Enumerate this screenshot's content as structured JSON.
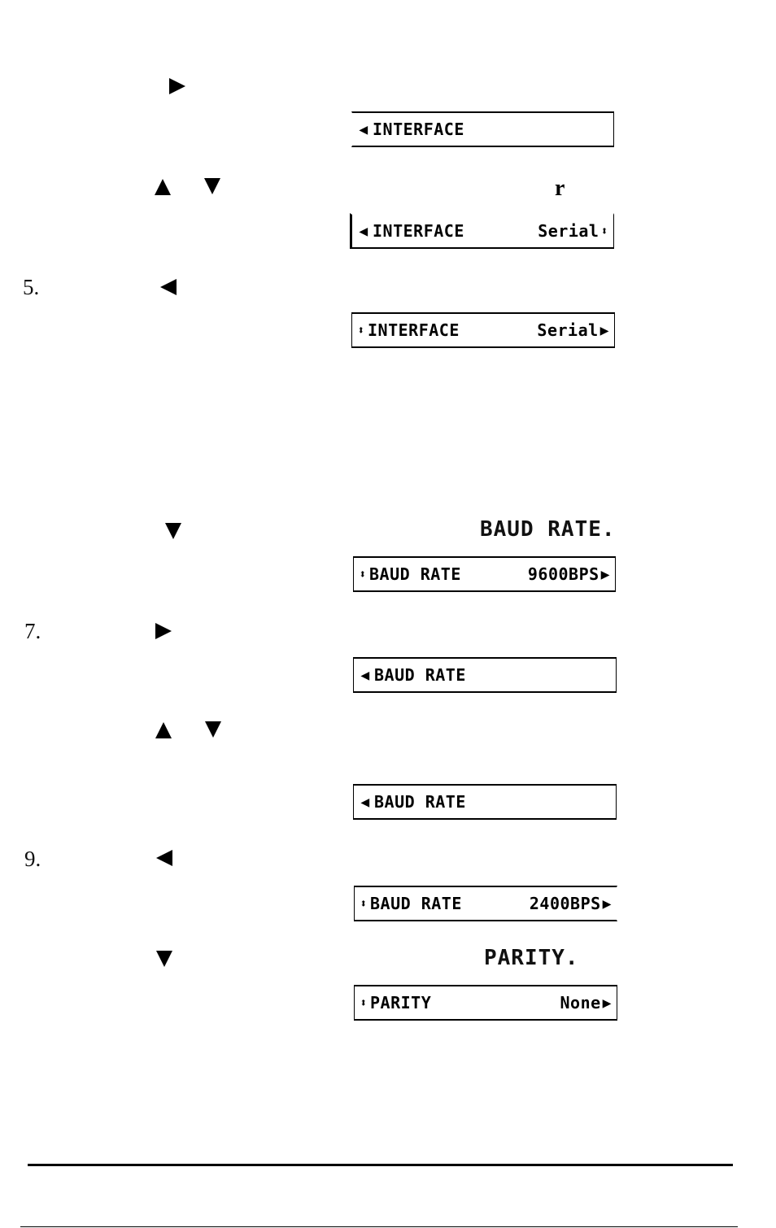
{
  "page": {
    "steps": [
      {
        "number": "",
        "button": "right-arrow"
      },
      {
        "number": "",
        "buttons": [
          "up-arrow",
          "down-arrow"
        ]
      },
      {
        "number": "5.",
        "button": "left-arrow"
      },
      {
        "number": "",
        "button": "down-arrow",
        "inline_setting": "BAUD RATE."
      },
      {
        "number": "7.",
        "button": "right-arrow"
      },
      {
        "number": "",
        "buttons": [
          "up-arrow",
          "down-arrow"
        ]
      },
      {
        "number": "9.",
        "button": "left-arrow"
      },
      {
        "number": "",
        "button": "down-arrow",
        "inline_setting": "PARITY."
      }
    ],
    "stray_char": "r",
    "displays": [
      {
        "lead": "◀",
        "label": "INTERFACE",
        "value": "",
        "trail": ""
      },
      {
        "lead": "◀",
        "label": "INTERFACE",
        "value": "Serial",
        "trail": "⬍"
      },
      {
        "lead": "⬍",
        "label": "INTERFACE",
        "value": "Serial",
        "trail": "▶"
      },
      {
        "lead": "⬍",
        "label": "BAUD RATE",
        "value": "9600BPS",
        "trail": "▶"
      },
      {
        "lead": "◀",
        "label": "BAUD RATE",
        "value": "",
        "trail": ""
      },
      {
        "lead": "◀",
        "label": "BAUD RATE",
        "value": "",
        "trail": ""
      },
      {
        "lead": "⬍",
        "label": "BAUD RATE",
        "value": "2400BPS",
        "trail": "▶"
      },
      {
        "lead": "⬍",
        "label": "PARITY",
        "value": "None",
        "trail": "▶"
      }
    ]
  }
}
